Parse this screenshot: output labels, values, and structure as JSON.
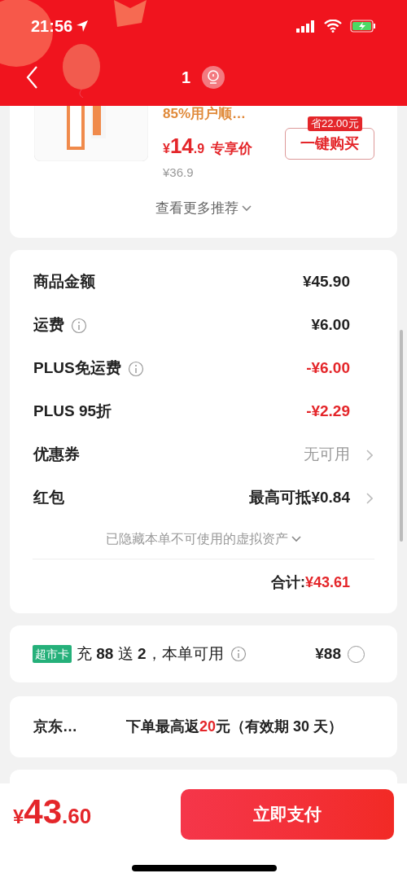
{
  "status_bar": {
    "time": "21:56",
    "battery_charging": true
  },
  "header": {
    "title": "1"
  },
  "product": {
    "tagline": "85%用户顺…",
    "price": {
      "currency": "¥",
      "integer": "14",
      "decimal": ".9"
    },
    "price_label": "专享价",
    "original_price": "¥36.9",
    "saving_badge": "省22.00元",
    "buy_button": "一键购买"
  },
  "more_link": "查看更多推荐",
  "summary": {
    "rows": [
      {
        "label": "商品金额",
        "value": "¥45.90",
        "kind": "normal",
        "info": false,
        "arrow": false
      },
      {
        "label": "运费",
        "value": "¥6.00",
        "kind": "normal",
        "info": true,
        "arrow": false
      },
      {
        "label": "PLUS免运费",
        "value": "-¥6.00",
        "kind": "discount",
        "info": true,
        "arrow": false
      },
      {
        "label": "PLUS 95折",
        "value": "-¥2.29",
        "kind": "discount",
        "info": false,
        "arrow": false
      },
      {
        "label": "优惠券",
        "value": "无可用",
        "kind": "muted",
        "info": false,
        "arrow": true
      },
      {
        "label": "红包",
        "value": "最高可抵¥0.84",
        "kind": "normal",
        "info": false,
        "arrow": true
      }
    ],
    "hidden_assets": "已隐藏本单不可使用的虚拟资产",
    "total_label": "合计:",
    "total_value": "¥43.61"
  },
  "card_offer": {
    "tag": "超市卡",
    "text": "充 **88** 送 **2**，本单可用",
    "price": "¥88",
    "selected": false
  },
  "rebate": {
    "label": "京东…",
    "before": "下单最高返",
    "highlight": "20",
    "after": "元（有效期 30 天）"
  },
  "footer": {
    "price": {
      "currency": "¥",
      "integer": "43",
      "decimal": ".60"
    },
    "pay_button": "立即支付"
  }
}
